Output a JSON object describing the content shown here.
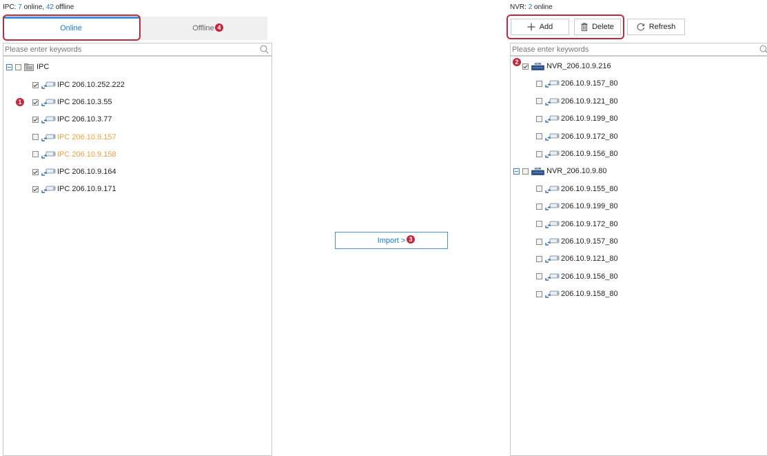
{
  "ipc_status": {
    "prefix": "IPC:",
    "online_count": "7",
    "online_text": "online",
    "separator": ",",
    "offline_count": "42",
    "offline_text": "offline"
  },
  "nvr_status": {
    "prefix": "NVR:",
    "online_count": "2",
    "online_text": "online"
  },
  "tabs": {
    "online": "Online",
    "offline": "Offline"
  },
  "left_search": {
    "placeholder": "Please enter keywords"
  },
  "right_search": {
    "placeholder": "Please enter keywords"
  },
  "ipc_tree": {
    "root_label": "IPC",
    "items": [
      {
        "label": "IPC 206.10.252.222",
        "checked": true,
        "color": "normal"
      },
      {
        "label": "IPC 206.10.3.55",
        "checked": true,
        "color": "normal"
      },
      {
        "label": "IPC 206.10.3.77",
        "checked": true,
        "color": "normal"
      },
      {
        "label": "IPC 206.10.9.157",
        "checked": false,
        "color": "orange"
      },
      {
        "label": "IPC 206.10.9.158",
        "checked": false,
        "color": "orange"
      },
      {
        "label": "IPC 206.10.9.164",
        "checked": true,
        "color": "normal"
      },
      {
        "label": "IPC 206.10.9.171",
        "checked": true,
        "color": "normal"
      }
    ]
  },
  "toolbar": {
    "add": "Add",
    "delete": "Delete",
    "refresh": "Refresh"
  },
  "import_button": {
    "label": "Import >"
  },
  "nvr_tree": {
    "groups": [
      {
        "label": "NVR_206.10.9.216",
        "checked": true,
        "items": [
          "206.10.9.157_80",
          "206.10.9.121_80",
          "206.10.9.199_80",
          "206.10.9.172_80",
          "206.10.9.156_80"
        ]
      },
      {
        "label": "NVR_206.10.9.80",
        "checked": false,
        "items": [
          "206.10.9.155_80",
          "206.10.9.199_80",
          "206.10.9.172_80",
          "206.10.9.157_80",
          "206.10.9.121_80",
          "206.10.9.156_80",
          "206.10.9.158_80"
        ]
      }
    ]
  },
  "nvr_icon_text": "NVR",
  "callouts": {
    "one": "1",
    "two": "2",
    "three": "3",
    "four": "4"
  },
  "colors": {
    "accent": "#1a7bd0",
    "callout": "#c0283d",
    "offline_text": "#f0a03c"
  }
}
